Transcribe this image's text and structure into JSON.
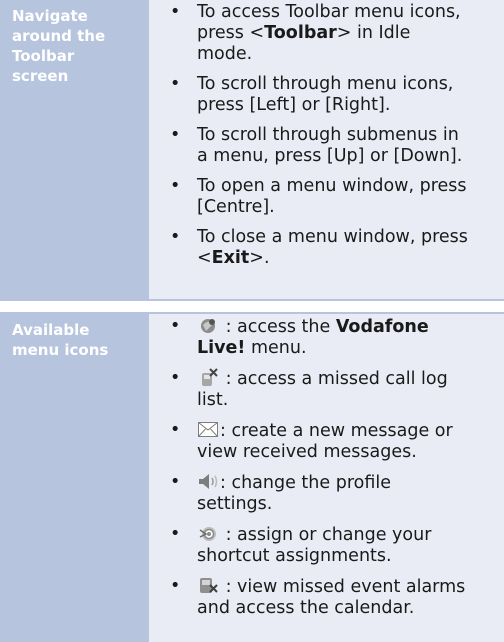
{
  "navigate": {
    "heading": [
      "Navigate",
      "around the",
      "Toolbar",
      "screen"
    ],
    "items": [
      {
        "lines": [
          "To access Toolbar menu icons,",
          "press <{{Toolbar}}> in Idle",
          "mode."
        ]
      },
      {
        "lines": [
          "To scroll through menu icons,",
          "press [Left] or [Right]."
        ]
      },
      {
        "lines": [
          "To scroll through submenus in",
          "a menu, press [Up] or [Down]."
        ]
      },
      {
        "lines": [
          "To open a menu window, press",
          "[Centre]."
        ]
      },
      {
        "lines": [
          "To close a menu window, press",
          "<{{Exit}}>."
        ]
      }
    ]
  },
  "menu_icons": {
    "heading": [
      "Available",
      "menu icons"
    ],
    "items": [
      {
        "icon": "vodafone-live-icon",
        "lines": [
          " : access the {{Vodafone}}",
          "{{Live!}} menu."
        ]
      },
      {
        "icon": "missed-call-icon",
        "lines": [
          " : access a missed call log",
          "list."
        ]
      },
      {
        "icon": "envelope-icon",
        "lines": [
          ": create a new message or",
          "view received messages."
        ]
      },
      {
        "icon": "speaker-icon",
        "lines": [
          ": change the profile",
          "settings."
        ]
      },
      {
        "icon": "shortcut-icon",
        "lines": [
          " : assign or change your",
          "shortcut assignments."
        ]
      },
      {
        "icon": "calendar-alarm-icon",
        "lines": [
          " : view missed event alarms",
          "and access the calendar."
        ]
      }
    ]
  },
  "colors": {
    "heading_bg": "#b7c4de",
    "body_bg": "#e9ecf5",
    "heading_text": "#ffffff"
  }
}
